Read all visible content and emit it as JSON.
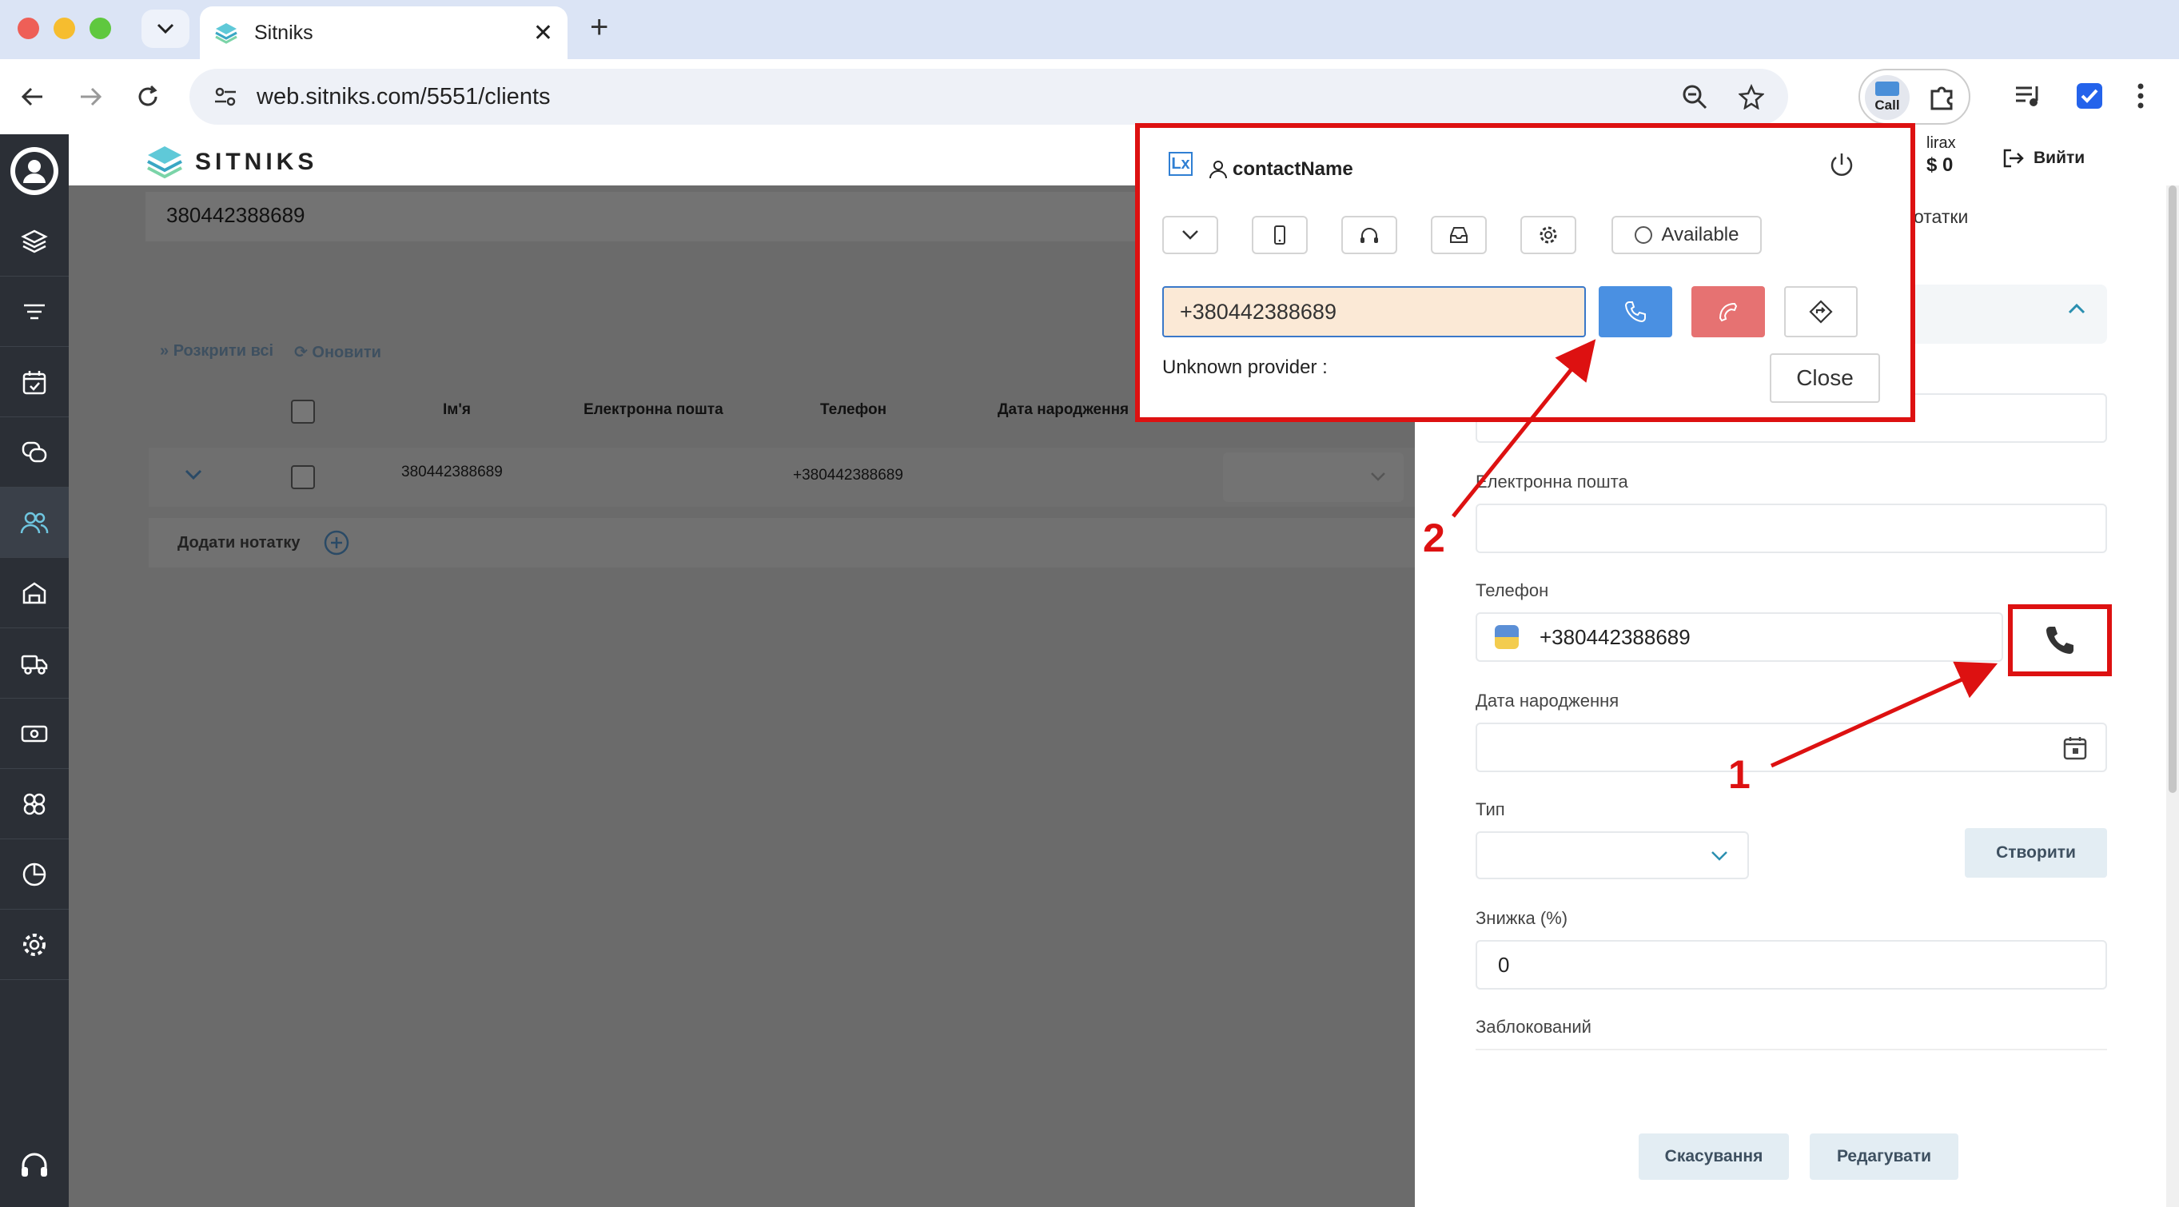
{
  "browser": {
    "tab_title": "Sitniks",
    "tab_close": "✕",
    "new_tab": "+",
    "url": "web.sitniks.com/5551/clients",
    "extension_call_label": "Call"
  },
  "app": {
    "brand": "SITNIKS",
    "account_name": "lirax",
    "account_balance": "$ 0",
    "logout_label": "Вийти"
  },
  "clients_list": {
    "search_value": "380442388689",
    "expand_all_label": "Розкрити всі",
    "refresh_label": "Оновити",
    "columns": [
      "Ім'я",
      "Електронна пошта",
      "Телефон",
      "Дата народження"
    ],
    "rows": [
      {
        "name": "380442388689",
        "email": "",
        "phone": "+380442388689",
        "birthday": ""
      }
    ],
    "add_note_label": "Додати нотатку"
  },
  "side_panel": {
    "notes_label": "отатки",
    "email_label": "Електронна пошта",
    "phone_label": "Телефон",
    "phone_value": "+380442388689",
    "birthday_label": "Дата народження",
    "type_label": "Тип",
    "create_label": "Створити",
    "discount_label": "Знижка (%)",
    "discount_value": "0",
    "blocked_label": "Заблокований",
    "cancel_label": "Скасування",
    "edit_label": "Редагувати"
  },
  "popup": {
    "logo_text": "Lx",
    "contact_name": "contactName",
    "status_label": "Available",
    "dial_value": "+380442388689",
    "provider_label": "Unknown provider :",
    "close_label": "Close"
  },
  "annotations": {
    "step1": "1",
    "step2": "2"
  },
  "colors": {
    "highlight_red": "#dd1111",
    "call_blue": "#4a90e2",
    "hangup_red": "#e67272",
    "rail_dark": "#2b2f36"
  }
}
